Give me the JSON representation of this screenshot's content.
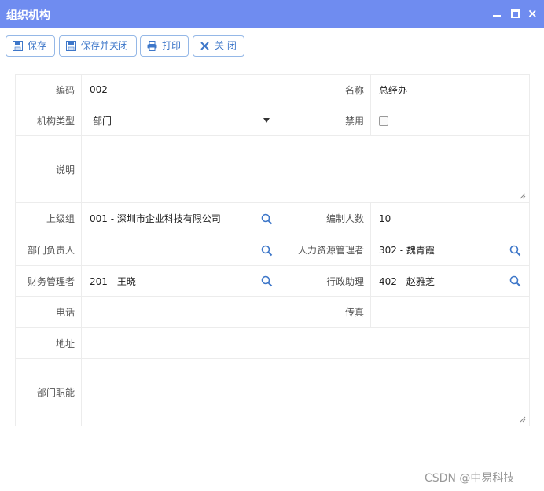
{
  "window": {
    "title": "组织机构"
  },
  "toolbar": {
    "save": "保存",
    "save_close": "保存并关闭",
    "print": "打印",
    "close": "关 闭"
  },
  "form": {
    "code_label": "编码",
    "code_value": "002",
    "name_label": "名称",
    "name_value": "总经办",
    "type_label": "机构类型",
    "type_value": "部门",
    "disabled_label": "禁用",
    "desc_label": "说明",
    "desc_value": "",
    "parent_label": "上级组",
    "parent_value": "001 - 深圳市企业科技有限公司",
    "headcount_label": "编制人数",
    "headcount_value": "10",
    "leader_label": "部门负责人",
    "leader_value": "",
    "hr_label": "人力资源管理者",
    "hr_value": "302 - 魏青霞",
    "finance_label": "财务管理者",
    "finance_value": "201 - 王晓",
    "admin_label": "行政助理",
    "admin_value": "402 - 赵雅芝",
    "phone_label": "电话",
    "phone_value": "",
    "fax_label": "传真",
    "fax_value": "",
    "address_label": "地址",
    "address_value": "",
    "duty_label": "部门职能",
    "duty_value": ""
  },
  "watermark": "CSDN @中易科技"
}
